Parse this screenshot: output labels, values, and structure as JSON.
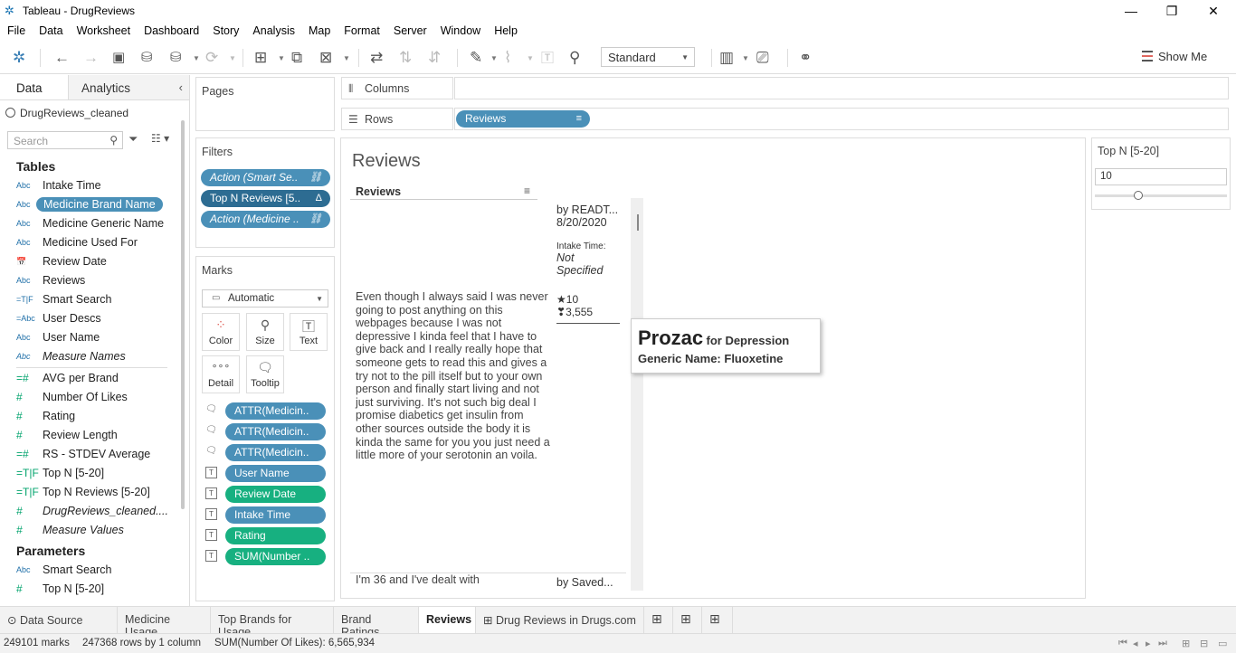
{
  "window": {
    "title": "Tableau - DrugReviews",
    "minimize": "—",
    "restore": "❐",
    "close": "✕"
  },
  "menu": [
    "File",
    "Data",
    "Worksheet",
    "Dashboard",
    "Story",
    "Analysis",
    "Map",
    "Format",
    "Server",
    "Window",
    "Help"
  ],
  "toolbar": {
    "fit_select": "Standard",
    "show_me": "Show Me"
  },
  "left_pane": {
    "tab_data": "Data",
    "tab_analytics": "Analytics",
    "datasource": "DrugReviews_cleaned",
    "search_placeholder": "Search",
    "tables_heading": "Tables",
    "tables": [
      {
        "icon": "Abc",
        "name": "Intake Time"
      },
      {
        "icon": "Abc",
        "name": "Medicine Brand Name"
      },
      {
        "icon": "Abc",
        "name": "Medicine Generic Name"
      },
      {
        "icon": "Abc",
        "name": "Medicine Used For"
      },
      {
        "icon": "📅",
        "name": "Review Date"
      },
      {
        "icon": "Abc",
        "name": "Reviews"
      },
      {
        "icon": "=T|F",
        "name": "Smart Search"
      },
      {
        "icon": "=Abc",
        "name": "User Descs"
      },
      {
        "icon": "Abc",
        "name": "User Name"
      },
      {
        "icon": "Abc",
        "name": "Measure Names"
      }
    ],
    "measures": [
      {
        "icon": "=#",
        "name": "AVG per Brand"
      },
      {
        "icon": "#",
        "name": "Number Of Likes"
      },
      {
        "icon": "#",
        "name": "Rating"
      },
      {
        "icon": "#",
        "name": "Review Length"
      },
      {
        "icon": "=#",
        "name": "RS - STDEV Average"
      },
      {
        "icon": "=T|F",
        "name": "Top N [5-20]"
      },
      {
        "icon": "=T|F",
        "name": "Top N Reviews [5-20]"
      },
      {
        "icon": "#",
        "name": "DrugReviews_cleaned...."
      },
      {
        "icon": "#",
        "name": "Measure Values"
      }
    ],
    "parameters_heading": "Parameters",
    "parameters": [
      {
        "icon": "Abc",
        "name": "Smart Search"
      },
      {
        "icon": "#",
        "name": "Top N [5-20]"
      }
    ]
  },
  "pages": {
    "title": "Pages"
  },
  "filters": {
    "title": "Filters",
    "pills": [
      "Action (Smart Se..",
      "Top N Reviews [5..",
      "Action (Medicine .."
    ]
  },
  "marks": {
    "title": "Marks",
    "type": "Automatic",
    "buttons": {
      "color": "Color",
      "size": "Size",
      "text": "Text",
      "detail": "Detail",
      "tooltip": "Tooltip"
    },
    "rows": [
      {
        "pill": "ATTR(Medicin..",
        "style": "blue"
      },
      {
        "pill": "ATTR(Medicin..",
        "style": "blue"
      },
      {
        "pill": "ATTR(Medicin..",
        "style": "blue"
      },
      {
        "pill": "User Name",
        "style": "blue"
      },
      {
        "pill": "Review Date",
        "style": "green"
      },
      {
        "pill": "Intake Time",
        "style": "blue"
      },
      {
        "pill": "Rating",
        "style": "green"
      },
      {
        "pill": "SUM(Number ..",
        "style": "green"
      }
    ]
  },
  "shelves": {
    "columns_label": "Columns",
    "rows_label": "Rows",
    "rows_pill": "Reviews"
  },
  "view": {
    "title": "Reviews",
    "column_header": "Reviews",
    "review1": {
      "text": "Even though I always said I was never going to post anything on this webpages because I was not depressive I kinda feel that I have to give back and I really really hope that someone gets to read this and gives a try not to the pill itself but to your own person and finally start living and not just surviving. It's not such big deal I promise diabetics get insulin from other sources outside the body it is kinda the same for you you just need a little more of your serotonin an voila.",
      "by": "by READT...",
      "date": "8/20/2020",
      "intake_label": "Intake Time:",
      "intake_value": "Not Specified",
      "rating": "10",
      "likes": "3,555"
    },
    "review2": {
      "text": "I'm 36 and I've dealt with",
      "by": "by Saved..."
    },
    "tooltip": {
      "brand": "Prozac",
      "for": "for Depression",
      "generic": "Generic Name: Fluoxetine"
    }
  },
  "parameter_card": {
    "title": "Top N [5-20]",
    "value": "10",
    "level": 0.33
  },
  "bottom_tabs": [
    "Data Source",
    "Medicine Usage",
    "Top Brands for Usage",
    "Brand Ratings",
    "Reviews",
    "Drug Reviews in Drugs.com"
  ],
  "status": {
    "marks": "249101 marks",
    "rows": "247368 rows by 1 column",
    "sum": "SUM(Number Of Likes): 6,565,934"
  }
}
